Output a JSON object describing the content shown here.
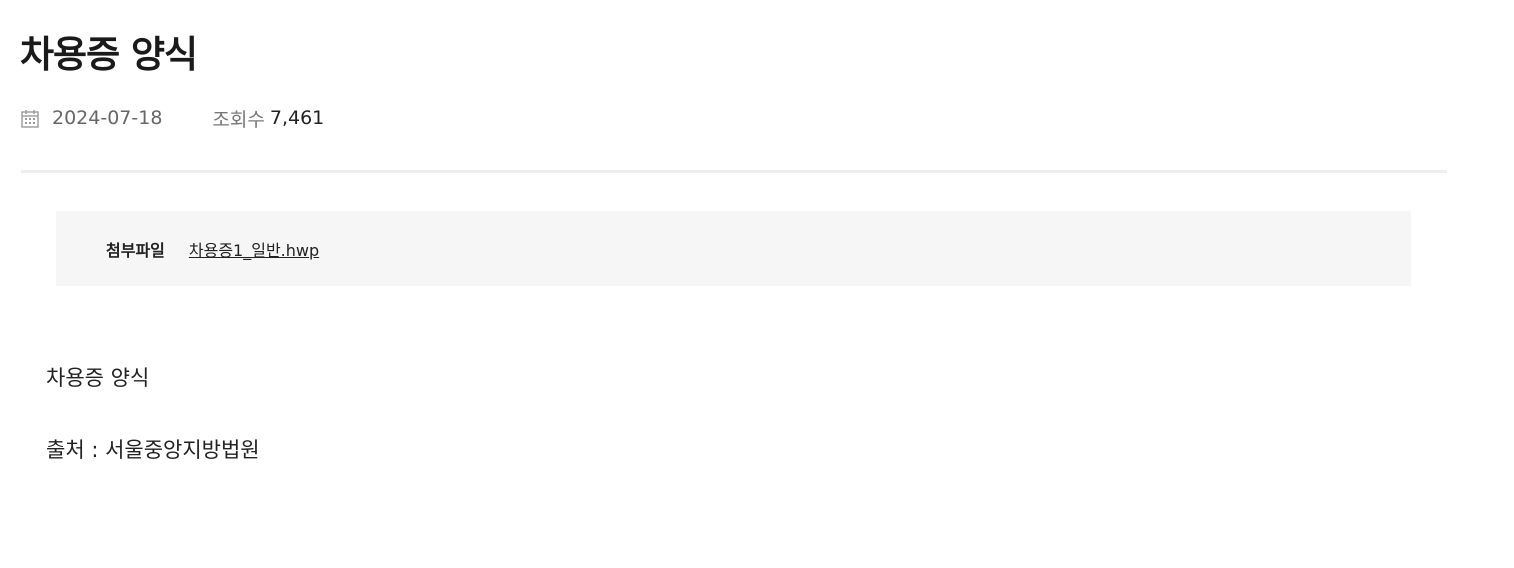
{
  "post": {
    "title": "차용증 양식",
    "date": "2024-07-18",
    "views_label": "조회수",
    "views_value": "7,461"
  },
  "attachment": {
    "label": "첨부파일",
    "file_name": "차용증1_일반.hwp"
  },
  "content": {
    "line1": "차용증 양식",
    "line2": "출처 : 서울중앙지방법원"
  },
  "icons": {
    "date": "calendar-icon"
  },
  "colors": {
    "title": "#1a1a1a",
    "meta_text": "#777777",
    "divider": "#eeeeee",
    "attachment_bg": "#f6f6f6"
  }
}
